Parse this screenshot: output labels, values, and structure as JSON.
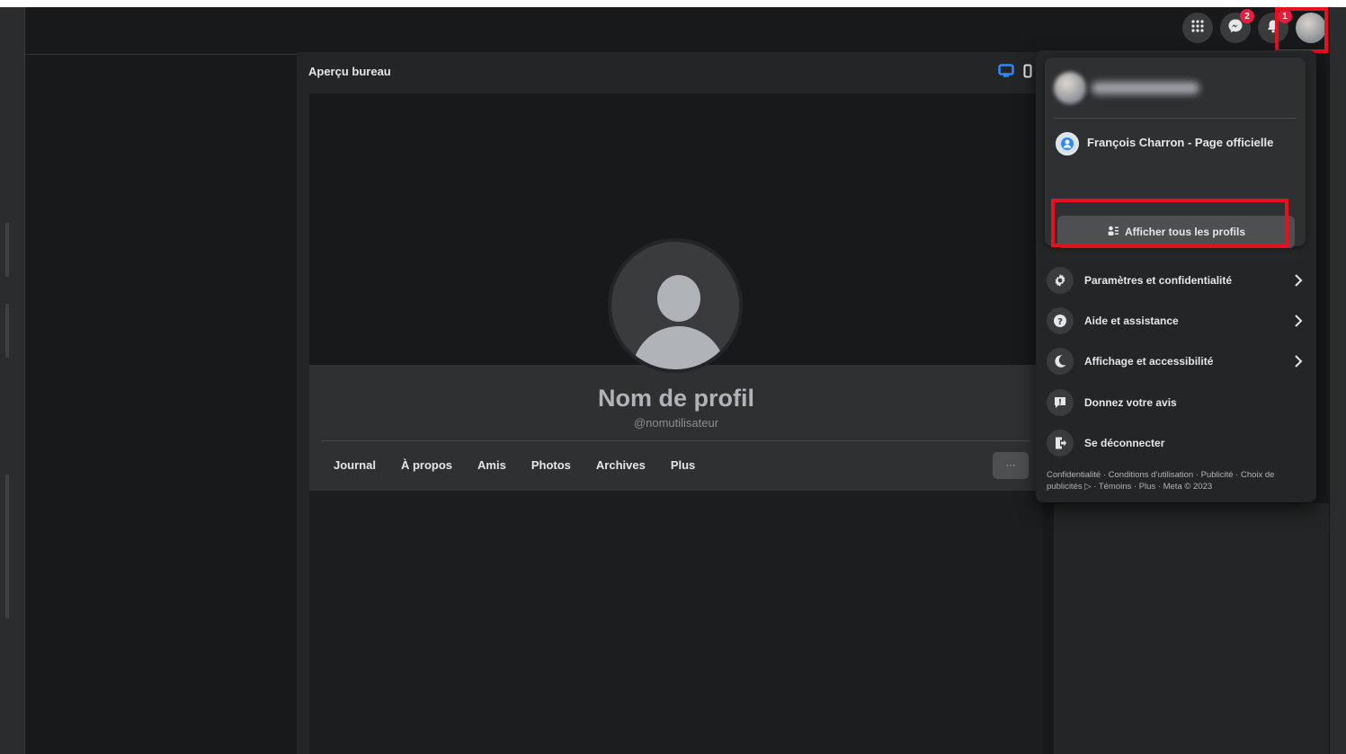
{
  "topnav": {
    "menu_icon": "grid-icon",
    "messenger_badge": "2",
    "notifications_badge": "1"
  },
  "preview": {
    "title": "Aperçu bureau",
    "profile_name": "Nom de profil",
    "username": "@nomutilisateur",
    "tabs": [
      "Journal",
      "À propos",
      "Amis",
      "Photos",
      "Archives",
      "Plus"
    ],
    "more_label": "···"
  },
  "menu": {
    "page_name": "François Charron - Page officielle",
    "all_profiles_label": "Afficher tous les profils",
    "items": [
      {
        "label": "Paramètres et confidentialité",
        "icon": "gear-icon",
        "chevron": true
      },
      {
        "label": "Aide et assistance",
        "icon": "help-icon",
        "chevron": true
      },
      {
        "label": "Affichage et accessibilité",
        "icon": "moon-icon",
        "chevron": true
      },
      {
        "label": "Donnez votre avis",
        "icon": "feedback-icon",
        "chevron": false
      },
      {
        "label": "Se déconnecter",
        "icon": "logout-icon",
        "chevron": false
      }
    ],
    "footer": "Confidentialité · Conditions d’utilisation · Publicité · Choix de publicités ▷ · Témoins · Plus · Meta © 2023"
  },
  "colors": {
    "highlight": "#e8101e",
    "badge": "#e41e3f",
    "panel": "#242526"
  }
}
